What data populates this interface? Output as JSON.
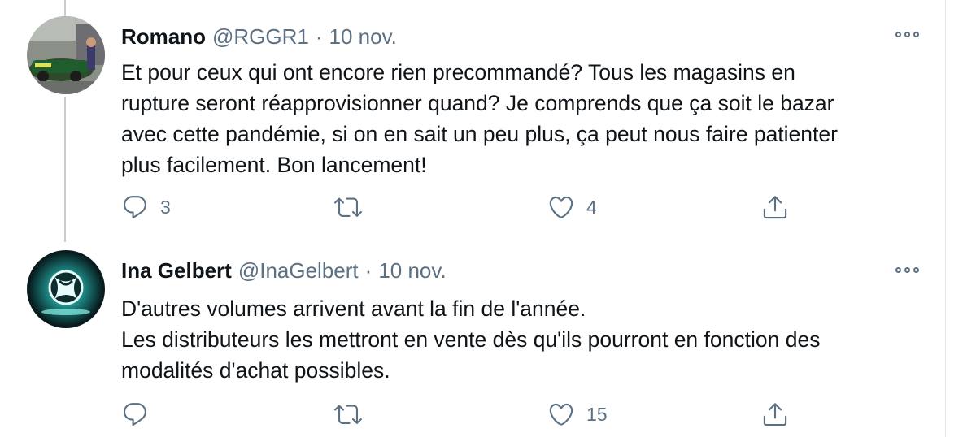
{
  "tweets": [
    {
      "name": "Romano",
      "handle": "@RGGR1",
      "separator": "·",
      "date": "10 nov.",
      "lines": [
        "Et pour ceux qui ont encore rien precommandé? Tous les magasins en",
        "rupture seront réapprovisionner quand? Je comprends que ça soit le bazar",
        "avec cette pandémie, si on en sait un peu plus, ça peut nous faire patienter",
        "plus facilement. Bon lancement!"
      ],
      "replies": "3",
      "retweets": "",
      "likes": "4"
    },
    {
      "name": "Ina Gelbert",
      "handle": "@InaGelbert",
      "separator": "·",
      "date": "10 nov.",
      "lines": [
        "D'autres volumes arrivent avant la fin de l'année.",
        "Les distributeurs les mettront en vente dès qu'ils pourront en fonction des",
        "modalités d'achat possibles."
      ],
      "replies": "",
      "retweets": "",
      "likes": "15"
    }
  ],
  "icons": {
    "reply": "reply-icon",
    "retweet": "retweet-icon",
    "like": "heart-icon",
    "share": "share-icon",
    "more": "more-options-icon"
  },
  "colors": {
    "muted": "#5b7083",
    "text": "#0f1419",
    "thread_line": "#c4cfd6"
  }
}
